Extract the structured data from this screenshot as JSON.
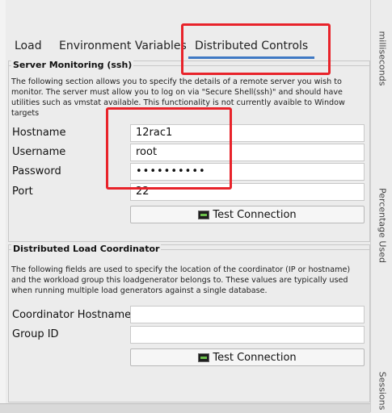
{
  "tabs": [
    {
      "label": "Load"
    },
    {
      "label": "Environment Variables"
    },
    {
      "label": "Distributed Controls",
      "active": true
    }
  ],
  "server_monitoring": {
    "title": "Server Monitoring (ssh)",
    "description": "The following section allows you to specify the details of a remote server you wish to monitor. The server must allow you to log on via \"Secure Shell(ssh)\" and should have utilities such as vmstat available. This functionality is not currently avaible to Window targets",
    "hostname_label": "Hostname",
    "hostname_value": "12rac1",
    "username_label": "Username",
    "username_value": "root",
    "password_label": "Password",
    "password_value": "••••••••••",
    "port_label": "Port",
    "port_value": "22",
    "test_button_label": "Test Connection"
  },
  "distributed_load": {
    "title": "Distributed Load Coordinator",
    "description": "The following fields are used to specify the location of the coordinator (IP or hostname) and the workload group this loadgenerator belongs to. These values are typically used when running multiple load generators against a single database.",
    "coordinator_label": "Coordinator Hostname",
    "coordinator_value": "",
    "group_label": "Group ID",
    "group_value": "",
    "test_button_label": "Test Connection"
  },
  "sidebar": {
    "labels": [
      "milliseconds",
      "Percentage Used",
      "Sessions"
    ]
  },
  "colors": {
    "highlight": "#e8232a",
    "tab_underline": "#3f79c4"
  }
}
